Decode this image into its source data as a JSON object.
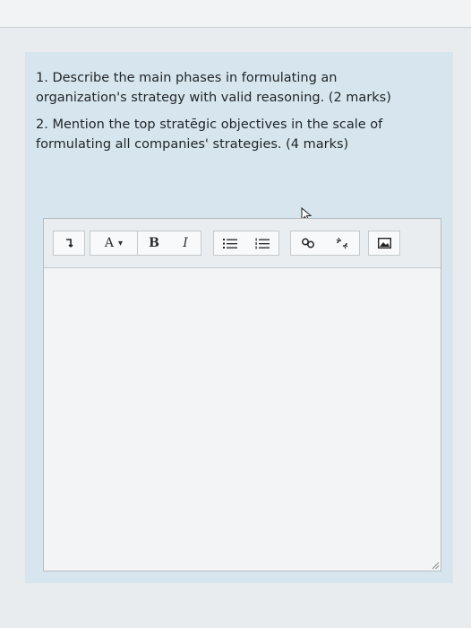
{
  "question": {
    "item1": "1. Describe the main phases in formulating an organization's strategy with valid reasoning. (2 marks)",
    "item2": "2. Mention the top stratēgic objectives in the scale of formulating all companies' strategies. (4 marks)"
  },
  "toolbar": {
    "paragraph_icon": "paragraph-format-icon",
    "font_label": "A",
    "font_caret": "▾",
    "bold_label": "B",
    "italic_label": "I",
    "bullet_icon": "bulleted-list-icon",
    "number_icon": "numbered-list-icon",
    "link_icon": "link-icon",
    "unlink_icon": "unlink-icon",
    "image_icon": "image-icon"
  },
  "editor": {
    "content": ""
  }
}
